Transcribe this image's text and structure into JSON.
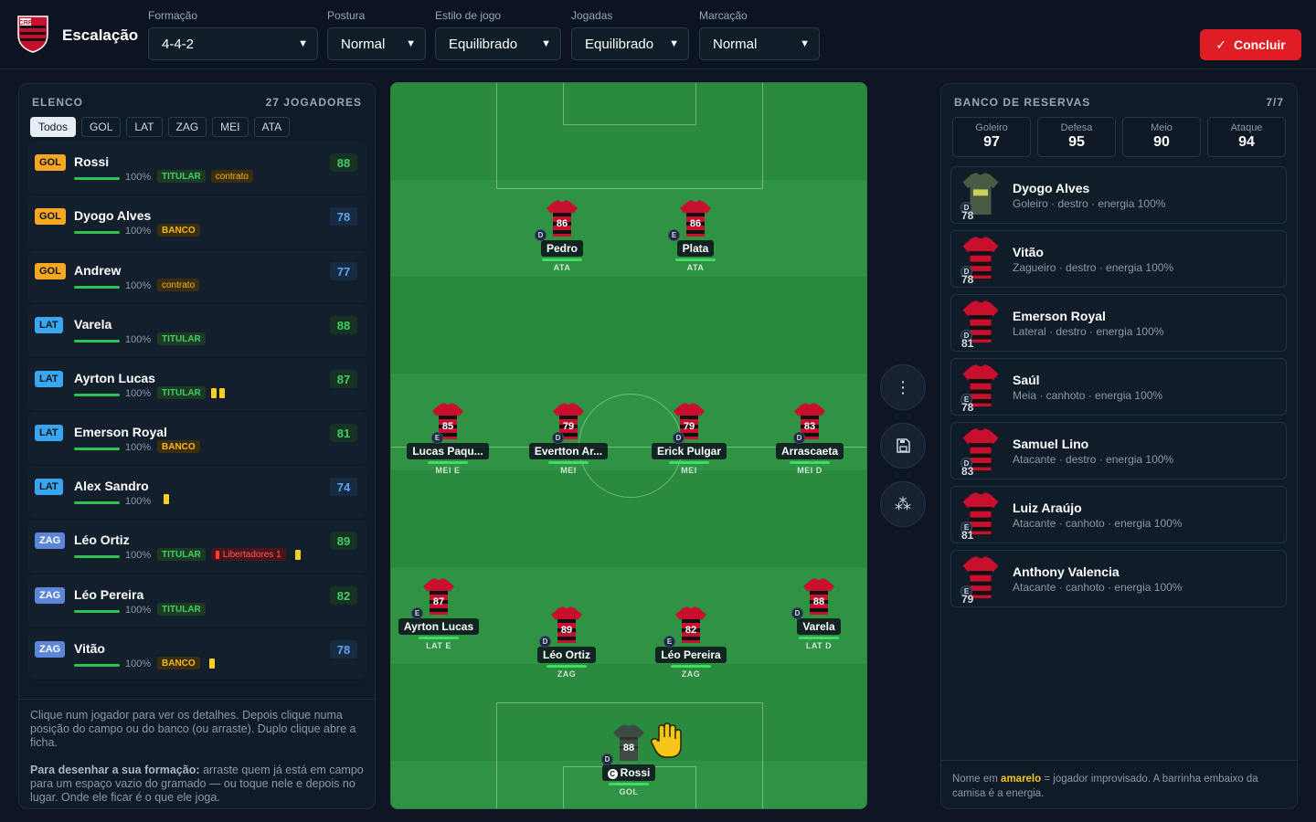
{
  "header": {
    "title": "Escalação",
    "formacao": {
      "label": "Formação",
      "value": "4-4-2"
    },
    "postura": {
      "label": "Postura",
      "value": "Normal"
    },
    "estilo": {
      "label": "Estilo de jogo",
      "value": "Equilibrado"
    },
    "jogadas": {
      "label": "Jogadas",
      "value": "Equilibrado"
    },
    "marcacao": {
      "label": "Marcação",
      "value": "Normal"
    },
    "concluir": "Concluir",
    "accent": "#e01c24"
  },
  "elenco": {
    "title": "ELENCO",
    "count": "27 JOGADORES",
    "filters": [
      "Todos",
      "GOL",
      "LAT",
      "ZAG",
      "MEI",
      "ATA"
    ],
    "players": [
      {
        "pos": "GOL",
        "name": "Rossi",
        "energy": "100%",
        "status": "TITULAR",
        "extra": "contrato",
        "rating": "88"
      },
      {
        "pos": "GOL",
        "name": "Dyogo Alves",
        "energy": "100%",
        "status": "BANCO",
        "rating": "78"
      },
      {
        "pos": "GOL",
        "name": "Andrew",
        "energy": "100%",
        "extra": "contrato",
        "rating": "77"
      },
      {
        "pos": "LAT",
        "name": "Varela",
        "energy": "100%",
        "status": "TITULAR",
        "rating": "88"
      },
      {
        "pos": "LAT",
        "name": "Ayrton Lucas",
        "energy": "100%",
        "status": "TITULAR",
        "rating": "87"
      },
      {
        "pos": "LAT",
        "name": "Emerson Royal",
        "energy": "100%",
        "status": "BANCO",
        "rating": "81"
      },
      {
        "pos": "LAT",
        "name": "Alex Sandro",
        "energy": "100%",
        "rating": "74"
      },
      {
        "pos": "ZAG",
        "name": "Léo Ortiz",
        "energy": "100%",
        "status": "TITULAR",
        "extra": "Libertadores 1",
        "rating": "89"
      },
      {
        "pos": "ZAG",
        "name": "Léo Pereira",
        "energy": "100%",
        "status": "TITULAR",
        "rating": "82"
      },
      {
        "pos": "ZAG",
        "name": "Vitão",
        "energy": "100%",
        "status": "BANCO",
        "rating": "78"
      }
    ],
    "help1": "Clique num jogador para ver os detalhes. Depois clique numa posição do campo ou do banco (ou arraste). Duplo clique abre a ficha.",
    "help2_bold": "Para desenhar a sua formação:",
    "help2": " arraste quem já está em campo para um espaço vazio do gramado — ou toque nele e depois no lugar. Onde ele ficar é o que ele joga."
  },
  "pitch": {
    "players": [
      {
        "name": "Pedro",
        "num": "86",
        "foot": "D",
        "role": "ATA"
      },
      {
        "name": "Plata",
        "num": "86",
        "foot": "E",
        "role": "ATA"
      },
      {
        "name": "Lucas Paqu...",
        "num": "85",
        "foot": "E",
        "role": "MEI E"
      },
      {
        "name": "Evertton Ar...",
        "num": "79",
        "foot": "D",
        "role": "MEI"
      },
      {
        "name": "Erick Pulgar",
        "num": "79",
        "foot": "D",
        "role": "MEI"
      },
      {
        "name": "Arrascaeta",
        "num": "83",
        "foot": "D",
        "role": "MEI D"
      },
      {
        "name": "Ayrton Lucas",
        "num": "87",
        "foot": "E",
        "role": "LAT E"
      },
      {
        "name": "Léo Ortiz",
        "num": "89",
        "foot": "D",
        "role": "ZAG"
      },
      {
        "name": "Léo Pereira",
        "num": "82",
        "foot": "E",
        "role": "ZAG"
      },
      {
        "name": "Varela",
        "num": "88",
        "foot": "D",
        "role": "LAT D"
      },
      {
        "name": "Rossi",
        "num": "88",
        "foot": "D",
        "role": "GOL"
      }
    ]
  },
  "banco": {
    "title": "BANCO DE RESERVAS",
    "count": "7/7",
    "stats": [
      {
        "label": "Goleiro",
        "value": "97"
      },
      {
        "label": "Defesa",
        "value": "95"
      },
      {
        "label": "Meio",
        "value": "90"
      },
      {
        "label": "Ataque",
        "value": "94"
      }
    ],
    "players": [
      {
        "name": "Dyogo Alves",
        "desc": "Goleiro · destro · energia 100%",
        "foot": "D",
        "num": "78",
        "kit": "gk"
      },
      {
        "name": "Vitão",
        "desc": "Zagueiro · destro · energia 100%",
        "foot": "D",
        "num": "78",
        "kit": "field"
      },
      {
        "name": "Emerson Royal",
        "desc": "Lateral · destro · energia 100%",
        "foot": "D",
        "num": "81",
        "kit": "field"
      },
      {
        "name": "Saúl",
        "desc": "Meia · canhoto · energia 100%",
        "foot": "E",
        "num": "78",
        "kit": "field"
      },
      {
        "name": "Samuel Lino",
        "desc": "Atacante · destro · energia 100%",
        "foot": "D",
        "num": "83",
        "kit": "field"
      },
      {
        "name": "Luiz Araújo",
        "desc": "Atacante · canhoto · energia 100%",
        "foot": "E",
        "num": "81",
        "kit": "field"
      },
      {
        "name": "Anthony Valencia",
        "desc": "Atacante · canhoto · energia 100%",
        "foot": "E",
        "num": "79",
        "kit": "field"
      }
    ],
    "legend_a": "Nome em ",
    "legend_y": "amarelo",
    "legend_b": " = jogador improvisado. A barrinha embaixo da camisa é a energia."
  }
}
